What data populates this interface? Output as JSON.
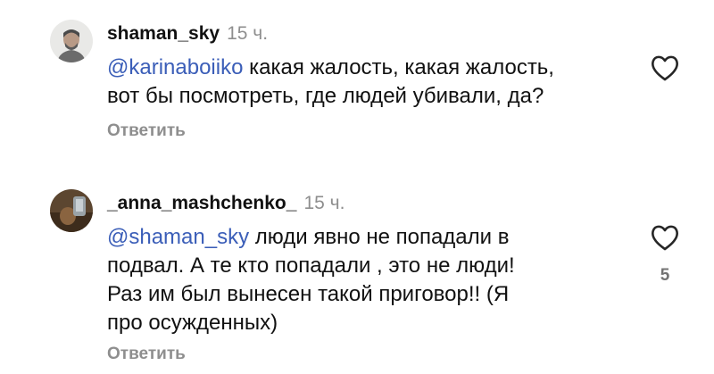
{
  "comments": [
    {
      "username": "shaman_sky",
      "time": "15 ч.",
      "mention": "@karinaboiiko",
      "text_line1": " какая жалость, какая жалость,",
      "text_line2": "вот бы посмотреть, где людей убивали, да?",
      "reply_label": "Ответить",
      "avatar_icon": "avatar-photo-man",
      "like_icon": "heart-outline-icon"
    },
    {
      "username": "_anna_mashchenko_",
      "time": "15 ч.",
      "mention": "@shaman_sky",
      "text_line1": " люди явно не попадали в",
      "text_line2": "подвал. А те кто попадали , это не люди!",
      "text_line3": "Раз им был вынесен такой приговор!! (Я",
      "text_line4": "про осужденных)",
      "reply_label": "Ответить",
      "likes": "5",
      "avatar_icon": "avatar-photo-portrait",
      "like_icon": "heart-outline-icon"
    }
  ],
  "colors": {
    "mention": "#3b5eb8",
    "secondary_text": "#8e8e8e"
  }
}
